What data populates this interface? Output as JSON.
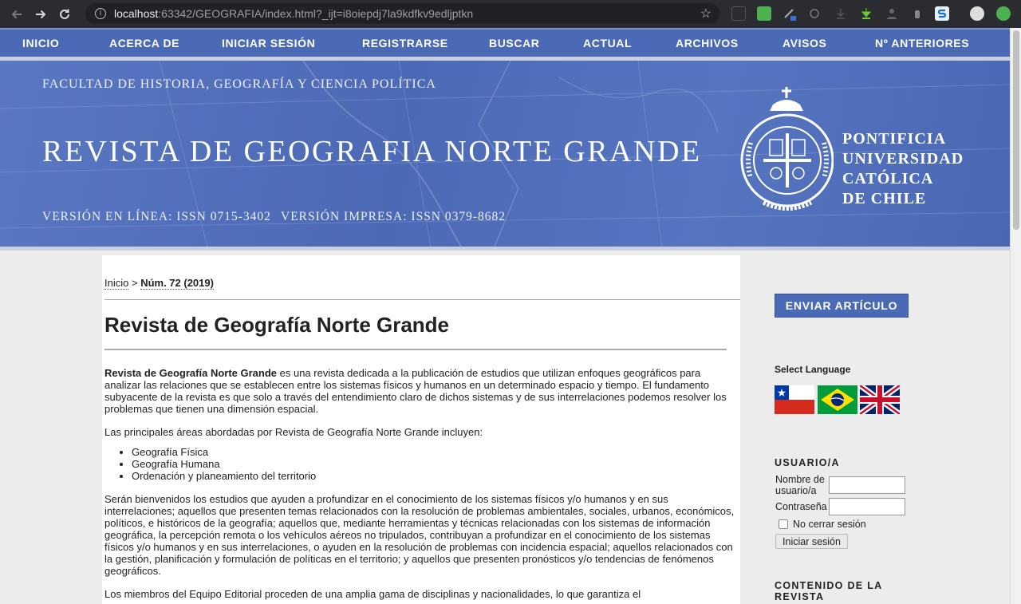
{
  "browser": {
    "url_host": "localhost",
    "url_path": ":63342/GEOGRAFIA/index.html?_ijt=i8oiepdj7la9kdfkv9edljptkn",
    "info_glyph": "i",
    "star_glyph": "☆"
  },
  "nav": {
    "items": [
      "INICIO",
      "ACERCA DE",
      "INICIAR SESIÓN",
      "REGISTRARSE",
      "BUSCAR",
      "ACTUAL",
      "ARCHIVOS",
      "AVISOS",
      "Nº ANTERIORES"
    ]
  },
  "header": {
    "faculty": "FACULTAD DE HISTORIA, GEOGRAFÍA Y CIENCIA POLÍTICA",
    "journal_title": "REVISTA DE GEOGRAFIA NORTE GRANDE",
    "issn_online": "VERSIÓN EN LÍNEA: ISSN 0715-3402",
    "issn_print": "VERSIÓN IMPRESA: ISSN 0379-8682",
    "university": [
      "PONTIFICIA",
      "UNIVERSIDAD",
      "CATÓLICA",
      "DE CHILE"
    ]
  },
  "breadcrumb": {
    "home": "Inicio",
    "separator": " > ",
    "current": "Núm. 72 (2019)"
  },
  "main": {
    "title": "Revista de Geografía Norte Grande",
    "intro_bold": "Revista de Geografía Norte Grande",
    "intro_rest": " es una revista dedicada a la publicación de estudios que utilizan enfoques geográficos para analizar las relaciones que se establecen entre los sistemas físicos y humanos en un determinado espacio y tiempo. El fundamento subyacente de la revista es que solo a través del entendimiento claro de dichos sistemas y de sus interrelaciones podemos resolver los problemas que tienen una dimensión espacial.",
    "areas_intro": "Las principales áreas abordadas por Revista de Geografía Norte Grande incluyen:",
    "areas": [
      "Geografía Física",
      "Geografía Humana",
      "Ordenación y planeamiento del territorio"
    ],
    "welcome": "Serán bienvenidos los estudios que ayuden a profundizar en el conocimiento de los sistemas físicos y/o humanos y en sus interrelaciones; aquellos que presenten temas relacionados con la resolución de problemas ambientales, sociales, urbanos, económicos, políticos, e históricos de la geografía; aquellos que, mediante herramientas y técnicas relacionadas con los sistemas de información geográfica, la percepción remota o los vehículos aéreos no tripulados, contribuyan a profundizar en el conocimiento de los sistemas físicos y/o humanos y en sus interrelaciones, o ayuden en la resolución de problemas con incidencia espacial; aquellos relacionados con la gestión, planificación y formulación de políticas en el territorio; y aquellos que presenten pronósticos y/o tendencias de fenómenos geográficos.",
    "editorial": "Los miembros del Equipo Editorial proceden de una amplia gama de disciplinas y nacionalidades, lo que garantiza el"
  },
  "sidebar": {
    "submit_label": "ENVIAR ARTÍCULO",
    "language_title": "Select Language",
    "languages": [
      "es",
      "pt",
      "en"
    ],
    "user_title": "USUARIO/A",
    "username_label": "Nombre de usuario/a",
    "password_label": "Contraseña",
    "remember_label": "No cerrar sesión",
    "login_label": "Iniciar sesión",
    "content_title": "CONTENIDO DE LA REVISTA"
  },
  "colors": {
    "nav_bg": "#4a6ab6",
    "banner_bg": "#4c69b5",
    "chrome_bg": "#2a2c30"
  }
}
